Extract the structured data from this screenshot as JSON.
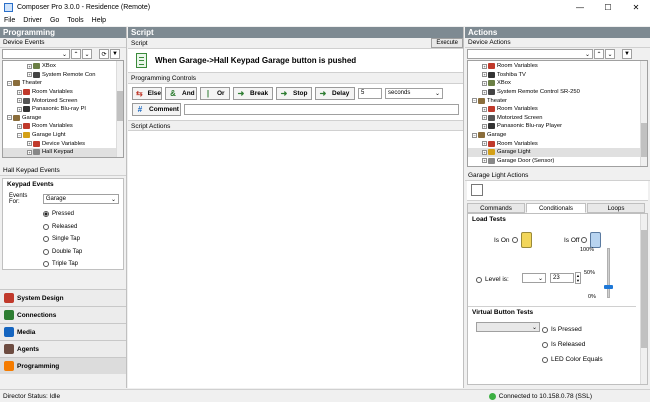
{
  "window": {
    "title": "Composer Pro 3.0.0 - Residence (Remote)",
    "minimize": "—",
    "maximize": "☐",
    "close": "✕"
  },
  "menu": [
    "File",
    "Driver",
    "Go",
    "Tools",
    "Help"
  ],
  "left": {
    "header": "Programming",
    "device_events_label": "Device Events",
    "tree": [
      {
        "label": "XBox",
        "indent": 3,
        "icon": "xbox-icon",
        "color": "#6b7f45"
      },
      {
        "label": "System Remote Con",
        "indent": 3,
        "icon": "remote-icon",
        "color": "#444"
      },
      {
        "label": "Theater",
        "indent": 1,
        "icon": "room-icon",
        "color": "#8a6d3b",
        "exp": "−"
      },
      {
        "label": "Room Variables",
        "indent": 2,
        "icon": "variables-icon",
        "color": "#c0392b",
        "exp": "+"
      },
      {
        "label": "Motorized Screen",
        "indent": 2,
        "icon": "screen-icon",
        "color": "#555",
        "exp": "+"
      },
      {
        "label": "Panasonic Blu-ray Pl",
        "indent": 2,
        "icon": "bluray-icon",
        "color": "#333",
        "exp": "+"
      },
      {
        "label": "Garage",
        "indent": 1,
        "icon": "room-icon",
        "color": "#8a6d3b",
        "exp": "−"
      },
      {
        "label": "Room Variables",
        "indent": 2,
        "icon": "variables-icon",
        "color": "#c0392b",
        "exp": "+"
      },
      {
        "label": "Garage Light",
        "indent": 2,
        "icon": "light-icon",
        "color": "#d4a017",
        "exp": "−"
      },
      {
        "label": "Device Variables",
        "indent": 3,
        "icon": "variables-icon",
        "color": "#c0392b",
        "exp": "+"
      },
      {
        "label": "Hall Keypad",
        "indent": 3,
        "icon": "keypad-icon",
        "color": "#888",
        "exp": "+",
        "selected": true
      }
    ],
    "events_title": "Hall Keypad Events",
    "keypad_events": "Keypad Events",
    "events_for_label": "Events For:",
    "events_for_value": "Garage",
    "radios": [
      {
        "label": "Pressed",
        "checked": true
      },
      {
        "label": "Released",
        "checked": false
      },
      {
        "label": "Single Tap",
        "checked": false
      },
      {
        "label": "Double Tap",
        "checked": false
      },
      {
        "label": "Triple Tap",
        "checked": false
      }
    ],
    "nav": [
      {
        "label": "System Design",
        "color": "#c0392b"
      },
      {
        "label": "Connections",
        "color": "#2e7d32"
      },
      {
        "label": "Media",
        "color": "#1565c0"
      },
      {
        "label": "Agents",
        "color": "#6d4c41"
      },
      {
        "label": "Programming",
        "color": "#f57c00"
      }
    ]
  },
  "script": {
    "header": "Script",
    "script_label": "Script",
    "execute": "Execute",
    "title": "When Garage->Hall Keypad Garage button is pushed",
    "controls_label": "Programming Controls",
    "controls": [
      {
        "label": "Else",
        "glyph": "⇆",
        "color": "#c0392b"
      },
      {
        "label": "And",
        "glyph": "&",
        "color": "#2e7d32"
      },
      {
        "label": "Or",
        "glyph": "|",
        "color": "#2e7d32"
      },
      {
        "label": "Break",
        "glyph": "➜",
        "color": "#2e7d32"
      },
      {
        "label": "Stop",
        "glyph": "➜",
        "color": "#2e7d32"
      },
      {
        "label": "Delay",
        "glyph": "➜",
        "color": "#2e7d32"
      }
    ],
    "delay_value": "5",
    "delay_unit": "seconds",
    "comment_label": "Comment",
    "actions_label": "Script Actions"
  },
  "right": {
    "header": "Actions",
    "device_actions_label": "Device Actions",
    "tree": [
      {
        "label": "Room Variables",
        "indent": 2,
        "icon": "variables-icon",
        "color": "#c0392b",
        "exp": "+"
      },
      {
        "label": "Toshiba TV",
        "indent": 2,
        "icon": "tv-icon",
        "color": "#333",
        "exp": "+"
      },
      {
        "label": "XBox",
        "indent": 2,
        "icon": "xbox-icon",
        "color": "#6b7f45",
        "exp": "+"
      },
      {
        "label": "System Remote Control SR-250",
        "indent": 2,
        "icon": "remote-icon",
        "color": "#444",
        "exp": "+"
      },
      {
        "label": "Theater",
        "indent": 1,
        "icon": "room-icon",
        "color": "#8a6d3b",
        "exp": "−"
      },
      {
        "label": "Room Variables",
        "indent": 2,
        "icon": "variables-icon",
        "color": "#c0392b",
        "exp": "+"
      },
      {
        "label": "Motorized Screen",
        "indent": 2,
        "icon": "screen-icon",
        "color": "#555",
        "exp": "+"
      },
      {
        "label": "Panasonic Blu-ray Player",
        "indent": 2,
        "icon": "bluray-icon",
        "color": "#333",
        "exp": "+"
      },
      {
        "label": "Garage",
        "indent": 1,
        "icon": "room-icon",
        "color": "#8a6d3b",
        "exp": "−"
      },
      {
        "label": "Room Variables",
        "indent": 2,
        "icon": "variables-icon",
        "color": "#c0392b",
        "exp": "+"
      },
      {
        "label": "Garage Light",
        "indent": 2,
        "icon": "light-icon",
        "color": "#d4a017",
        "exp": "+",
        "selected": true
      },
      {
        "label": "Garage Door (Sensor)",
        "indent": 2,
        "icon": "sensor-icon",
        "color": "#888",
        "exp": "+"
      }
    ],
    "light_actions_label": "Garage Light Actions",
    "tabs": [
      "Commands",
      "Conditionals",
      "Loops"
    ],
    "load_tests": "Load Tests",
    "is_on": "Is On",
    "is_off": "Is Off",
    "level_is": "Level is:",
    "level_value": "23",
    "slider_ticks": [
      "100%",
      "50%",
      "0%"
    ],
    "slider_level": 0.23,
    "virtual_tests": "Virtual Button Tests",
    "vb_options": [
      "Is Pressed",
      "Is Released",
      "LED Color Equals"
    ]
  },
  "status": {
    "left": "Director Status: Idle",
    "right": "Connected to 10.158.0.78 (SSL)"
  }
}
